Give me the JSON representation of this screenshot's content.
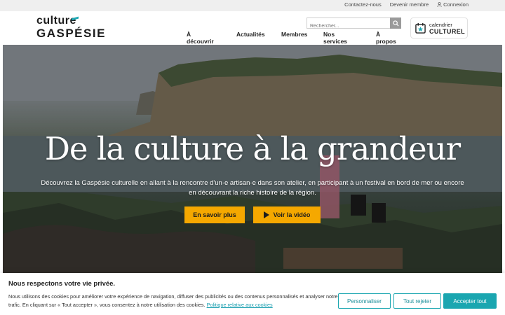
{
  "topbar": {
    "contact": "Contactez-nous",
    "member": "Devenir membre",
    "login": "Connexion"
  },
  "logo": {
    "line1": "culture",
    "line2": "GASPÉSIE"
  },
  "search": {
    "placeholder": "Rechercher..."
  },
  "nav": {
    "items": [
      "À découvrir",
      "Actualités",
      "Membres",
      "Nos services",
      "À propos"
    ]
  },
  "calendar": {
    "line1": "calendrier",
    "line2": "CULTUREL"
  },
  "hero": {
    "headline": "De la culture à la grandeur",
    "subtext": "Découvrez la Gaspésie culturelle en allant à la rencontre d'un·e artisan·e dans son atelier, en participant à un festival en bord de mer ou encore en découvrant la riche histoire de la région.",
    "button_more": "En savoir plus",
    "button_video": "Voir la vidéo"
  },
  "cookie": {
    "title": "Nous respectons votre vie privée.",
    "text": "Nous utilisons des cookies pour améliorer votre expérience de navigation, diffuser des publicités ou des contenus personnalisés et analyser notre trafic. En cliquant sur « Tout accepter », vous consentez à notre utilisation des cookies.",
    "policy_link": "Politique relative aux cookies",
    "customize": "Personnaliser",
    "reject": "Tout rejeter",
    "accept": "Accepter tout"
  },
  "colors": {
    "accent": "#1aa6b0",
    "button": "#f5a800"
  }
}
